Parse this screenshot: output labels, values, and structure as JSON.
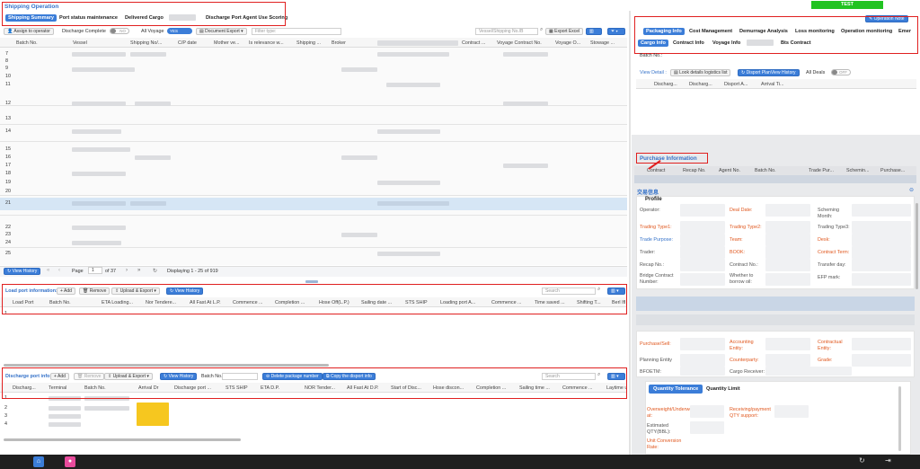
{
  "app": {
    "title": "Shipping Operation",
    "env_badge": "TEST"
  },
  "main_tabs": [
    "Shipping Summary",
    "Port status maintenance",
    "Delivered Cargo",
    "Discharge Port Agent Use Scoring"
  ],
  "toolbar": {
    "assign_label": "Assign to operator",
    "discharge_complete": "Discharge Complete",
    "discharge_toggle": "NO",
    "all_voyage": "All Voyage",
    "all_voyage_toggle": "YES",
    "document_export": "Document Export",
    "filter_placeholder": "Filter type:",
    "search_placeholder": "Vessel/Shipping No./B",
    "export_excel": "Export Excel"
  },
  "main_table": {
    "columns": [
      "Batch No.",
      "Vessel",
      "Shipping No/...",
      "C/P date",
      "Mother ve...",
      "Is relevance w...",
      "Shipping ...",
      "Broker",
      "Contract ...",
      "Voyage Contract No.",
      "Voyage O...",
      "Stowage ..."
    ],
    "rows": [
      "7",
      "8",
      "9",
      "10",
      "11",
      "12",
      "13",
      "14",
      "15",
      "16",
      "17",
      "18",
      "19",
      "20",
      "21",
      "22",
      "23",
      "24",
      "25"
    ]
  },
  "pagination": {
    "view_history": "View History",
    "page_label": "Page",
    "page": "1",
    "of_pages": "of 37",
    "displaying": "Displaying 1 - 25 of 919"
  },
  "load_port": {
    "title": "Load port information:",
    "add": "Add",
    "remove": "Remove",
    "upload_export": "Upload & Export",
    "view_history": "View History",
    "search_placeholder": "Search",
    "columns": [
      "Load Port",
      "Batch No.",
      "ETA Loading...",
      "Nor Tendere...",
      "All Fast At L.P.",
      "Commence ...",
      "Completion ...",
      "Hose Off(L.P.)",
      "Sailing date ...",
      "STS SHIP",
      "Loading port A...",
      "Commence ...",
      "Time saved ...",
      "Shifting T...",
      "Berl Ifl"
    ],
    "rows": [
      "1"
    ]
  },
  "discharge_port": {
    "title": "Discharge port info:",
    "add": "Add",
    "remove": "Remove",
    "upload_export": "Upload & Export",
    "view_history": "View History",
    "batch_label": "Batch No.",
    "delete_package": "Delete package number",
    "copy_disport": "Copy the disport info",
    "search_placeholder": "Search",
    "columns": [
      "Discharg...",
      "Terminal",
      "Batch No.",
      "Arrival Dr",
      "Discharge port ...",
      "STS SHIP",
      "ETA D.P.",
      "NOR Tender...",
      "All Fast At D.P.",
      "Start of Disc...",
      "Hose discon...",
      "Completion ...",
      "Sailing time ...",
      "Commence ...",
      "Laytime u"
    ],
    "rows": [
      "1",
      "2",
      "3",
      "4"
    ]
  },
  "right_panel": {
    "operation_note": "Operation Note",
    "tabs_row1": [
      "Packaging Info",
      "Cost Management",
      "Demurrage Analysis",
      "Loss monitoring",
      "Operation monitoring",
      "Emer"
    ],
    "tabs_row2": [
      "Cargo Info",
      "Contract Info",
      "Voyage Info",
      "",
      "Bts Contract"
    ],
    "batch_label": "Batch No.:",
    "view_detail": "View Detail :",
    "look_details": "Look details logistics list",
    "disport_history": "Disport PlanView History",
    "all_deals": "All Deals",
    "all_deals_toggle": "OFF",
    "detail_columns": [
      "Discharg...",
      "Discharg...",
      "Disport A...",
      "Arrival Ti..."
    ],
    "purchase_title": "Purchase Information",
    "purchase_columns": [
      "Contract",
      "Recap No.",
      "Agent No.",
      "Batch No.",
      "Trade Pur...",
      "Schemin...",
      "Purchase..."
    ],
    "trade_info_title": "交易信息",
    "profile_title": "Profile",
    "profile_fields": [
      {
        "label": "Operator:",
        "style": "normal"
      },
      {
        "label": "Deal Date:",
        "style": "red"
      },
      {
        "label": "Scheming Month:",
        "style": "normal"
      },
      {
        "label": "Trading Type1:",
        "style": "red"
      },
      {
        "label": "Trading Type2:",
        "style": "red"
      },
      {
        "label": "Trading Type3:",
        "style": "normal"
      },
      {
        "label": "Trade Purpose:",
        "style": "blue"
      },
      {
        "label": "Team:",
        "style": "red"
      },
      {
        "label": "Desk:",
        "style": "red"
      },
      {
        "label": "Trader:",
        "style": "normal"
      },
      {
        "label": "BOOK:",
        "style": "red"
      },
      {
        "label": "Contract Term:",
        "style": "red"
      },
      {
        "label": "Recap No.:",
        "style": "normal"
      },
      {
        "label": "Contract No.:",
        "style": "normal"
      },
      {
        "label": "Transfer day:",
        "style": "normal"
      },
      {
        "label": "Bridge Contract Number:",
        "style": "normal"
      },
      {
        "label": "Whether to borrow oil:",
        "style": "normal"
      },
      {
        "label": "EFP mark:",
        "style": "normal"
      }
    ],
    "section2_fields": [
      {
        "label": "Purchase/Sell:",
        "style": "red"
      },
      {
        "label": "Accounting Entity:",
        "style": "red"
      },
      {
        "label": "Contractual Entity:",
        "style": "red"
      },
      {
        "label": "Planning Entity",
        "style": "normal"
      },
      {
        "label": "Counterparty:",
        "style": "red"
      },
      {
        "label": "Grade:",
        "style": "red"
      },
      {
        "label": "BFOETM:",
        "style": "normal"
      },
      {
        "label": "Cargo Receiver:",
        "style": "normal"
      }
    ],
    "quantity_tabs": [
      "Quantity Tolerance",
      "Quantity Limit"
    ],
    "quantity_fields": [
      {
        "label": "Overweight/Underweight at:",
        "style": "red"
      },
      {
        "label": "Receiving/payment QTY support:",
        "style": "red"
      },
      {
        "label": "Estimated QTY(BBL):",
        "style": "normal"
      },
      {
        "label": "Unit Conversion Rate:",
        "style": "red"
      }
    ]
  },
  "colors": {
    "accent": "#3b7dd8",
    "highlight_row": "#d6e6f5",
    "env_badge": "#22c322",
    "annotation": "#e02020",
    "taskbar": "#1f1f1f"
  }
}
